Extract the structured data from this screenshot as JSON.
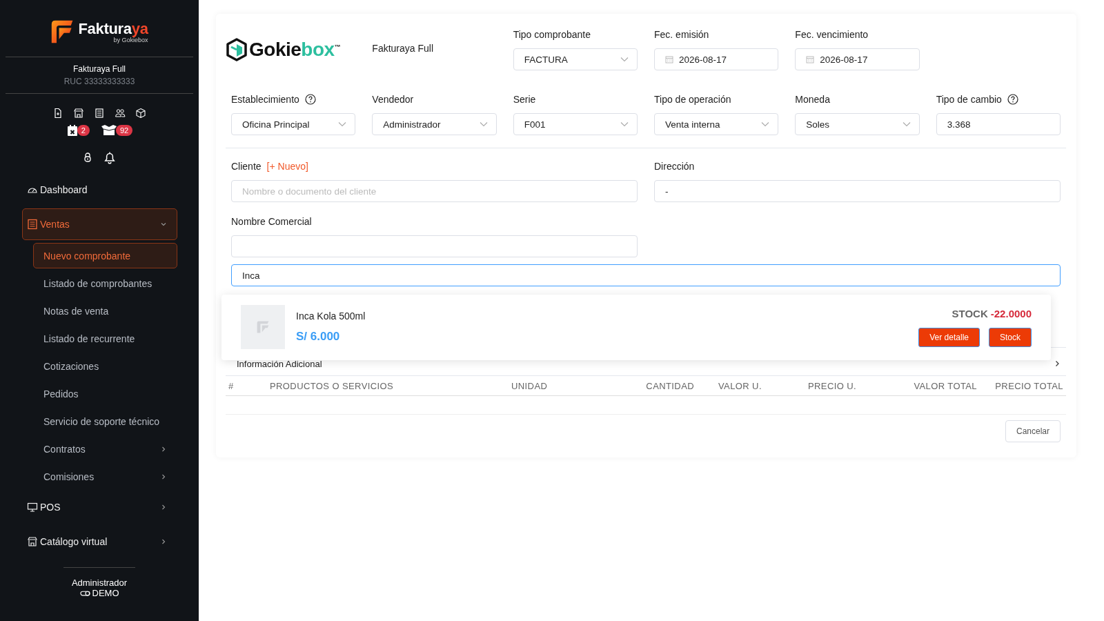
{
  "brand": {
    "name_main": "Faktura",
    "name_accent": "ya",
    "byline": "by Gokiebox"
  },
  "company": {
    "name": "Fakturaya Full",
    "ruc": "RUC 33333333333"
  },
  "badges": [
    {
      "kind": "calendar",
      "count": "2"
    },
    {
      "kind": "boxes",
      "count": "92"
    }
  ],
  "nav": [
    {
      "label": "Dashboard",
      "selected": false
    },
    {
      "label": "Ventas",
      "selected": true,
      "expanded": true,
      "children": [
        {
          "label": "Nuevo comprobante",
          "selected": true
        },
        {
          "label": "Listado de comprobantes",
          "selected": false
        },
        {
          "label": "Notas de venta",
          "selected": false
        },
        {
          "label": "Listado de recurrente",
          "selected": false
        },
        {
          "label": "Cotizaciones",
          "selected": false
        },
        {
          "label": "Pedidos",
          "selected": false
        },
        {
          "label": "Servicio de soporte técnico",
          "selected": false
        },
        {
          "label": "Contratos",
          "selected": false,
          "expanded": false
        },
        {
          "label": "Comisiones",
          "selected": false,
          "expanded": false
        }
      ]
    },
    {
      "label": "POS",
      "selected": false,
      "expanded": false
    },
    {
      "label": "Catálogo virtual",
      "selected": false,
      "expanded": false
    }
  ],
  "user": {
    "name": "Administrador",
    "mode": "DEMO"
  },
  "header": {
    "logo_main": "Gokie",
    "logo_accent": "box",
    "logo_mark": "™",
    "company": "Fakturaya Full"
  },
  "top_fields": [
    {
      "label": "Tipo comprobante",
      "kind": "select",
      "value": "FACTURA"
    },
    {
      "label": "Fec. emisión",
      "kind": "date",
      "value": "2026-08-17"
    },
    {
      "label": "Fec. vencimiento",
      "kind": "date",
      "value": "2026-08-17"
    }
  ],
  "fields": [
    {
      "label": "Establecimiento",
      "kind": "select",
      "value": "Oficina Principal",
      "help": true
    },
    {
      "label": "Vendedor",
      "kind": "select",
      "value": "Administrador",
      "help": false
    },
    {
      "label": "Serie",
      "kind": "select",
      "value": "F001",
      "help": false
    },
    {
      "label": "Tipo de operación",
      "kind": "select",
      "value": "Venta interna",
      "help": false
    },
    {
      "label": "Moneda",
      "kind": "select",
      "value": "Soles",
      "help": false
    },
    {
      "label": "Tipo de cambio",
      "kind": "input",
      "value": "3.368",
      "help": true
    }
  ],
  "client": {
    "label": "Cliente",
    "new_link": "[+ Nuevo]",
    "placeholder": "Nombre o documento del cliente"
  },
  "address": {
    "label": "Dirección",
    "value": "-"
  },
  "trade_name": {
    "label": "Nombre Comercial"
  },
  "product_search": {
    "value": "Inca"
  },
  "results": [
    {
      "name": "Inca Kola 500ml",
      "price": "S/ 6.000",
      "stock_label": "STOCK",
      "stock": "-22.0000",
      "buttons": [
        "Ver detalle",
        "Stock"
      ]
    }
  ],
  "additional_info": {
    "label": "Información Adicional",
    "expanded": false
  },
  "table": {
    "columns": [
      "#",
      "PRODUCTOS O SERVICIOS",
      "UNIDAD",
      "CANTIDAD",
      "VALOR U.",
      "PRECIO U.",
      "VALOR TOTAL",
      "PRECIO TOTAL"
    ]
  },
  "cancel_button": "Cancelar"
}
